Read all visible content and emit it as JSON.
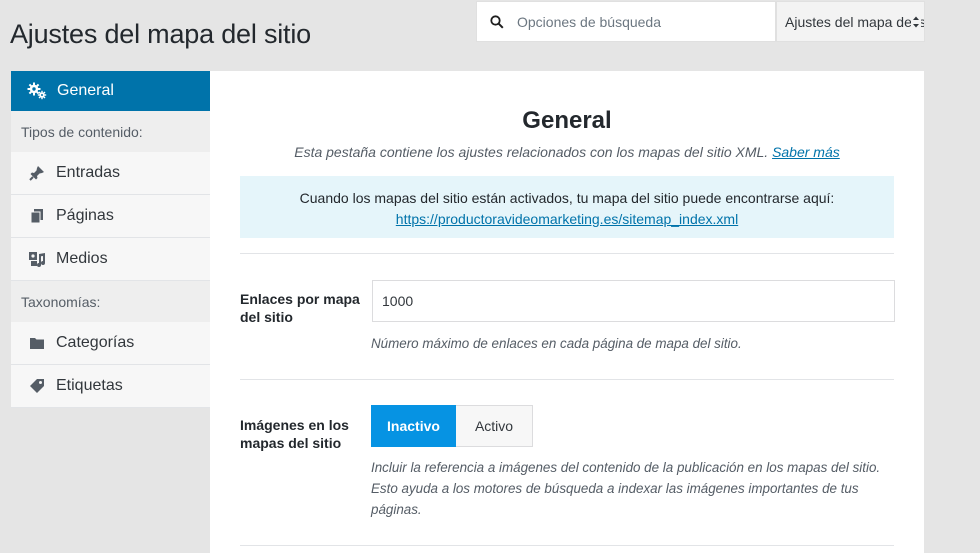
{
  "page": {
    "title": "Ajustes del mapa del sitio"
  },
  "search": {
    "placeholder": "Opciones de búsqueda"
  },
  "select": {
    "value": "Ajustes del mapa del sitio"
  },
  "sidebar": {
    "active": {
      "label": "General",
      "icon": "gears-icon"
    },
    "groups": [
      {
        "label": "Tipos de contenido:",
        "items": [
          {
            "label": "Entradas",
            "icon": "pin-icon"
          },
          {
            "label": "Páginas",
            "icon": "pages-icon"
          },
          {
            "label": "Medios",
            "icon": "media-icon"
          }
        ]
      },
      {
        "label": "Taxonomías:",
        "items": [
          {
            "label": "Categorías",
            "icon": "folder-icon"
          },
          {
            "label": "Etiquetas",
            "icon": "tag-icon"
          }
        ]
      }
    ]
  },
  "main": {
    "title": "General",
    "description": "Esta pestaña contiene los ajustes relacionados con los mapas del sitio XML.",
    "learn_more": "Saber más",
    "notice_text": "Cuando los mapas del sitio están activados, tu mapa del sitio puede encontrarse aquí:",
    "notice_link": "https://productoravideomarketing.es/sitemap_index.xml",
    "links_per_sitemap": {
      "label": "Enlaces por mapa del sitio",
      "value": "1000",
      "help": "Número máximo de enlaces en cada página de mapa del sitio."
    },
    "images": {
      "label": "Imágenes en los mapas del sitio",
      "off_label": "Inactivo",
      "on_label": "Activo",
      "help": "Incluir la referencia a imágenes del contenido de la publicación en los mapas del sitio. Esto ayuda a los motores de búsqueda a indexar las imágenes importantes de tus páginas."
    }
  },
  "colors": {
    "accent": "#0073aa",
    "toggle_active": "#0693e3",
    "notice_bg": "#e5f5fa"
  }
}
